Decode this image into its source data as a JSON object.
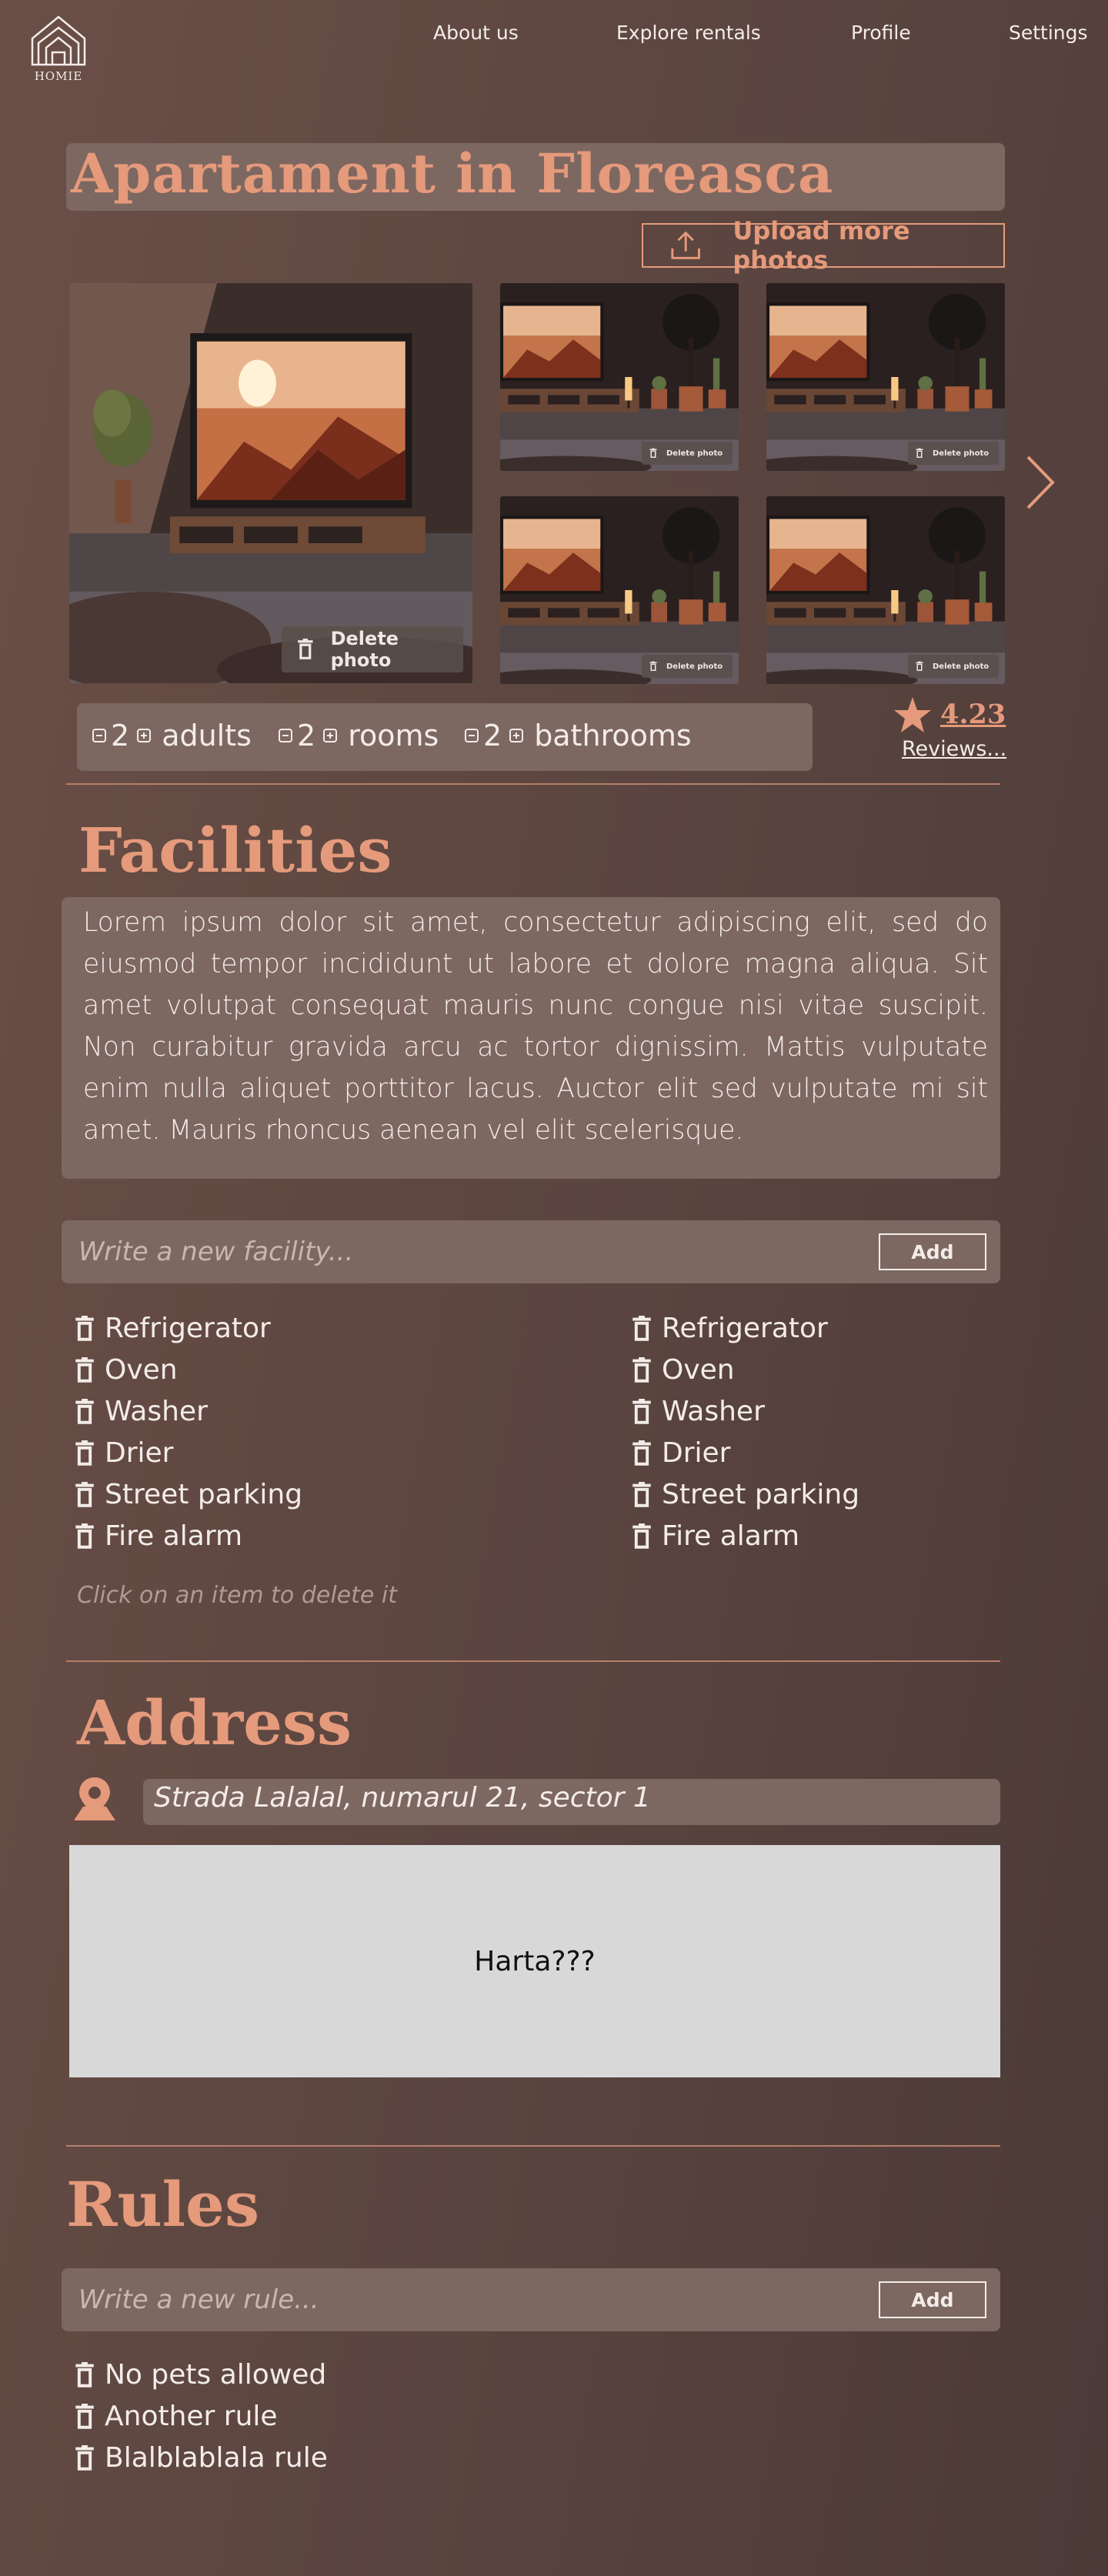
{
  "brand": {
    "name": "HOMIE"
  },
  "nav": {
    "about": "About us",
    "explore": "Explore rentals",
    "profile": "Profile",
    "settings": "Settings"
  },
  "listing": {
    "title": "Apartament in Floreasca",
    "upload_label": "Upload more photos",
    "delete_photo_label": "Delete photo",
    "counters": {
      "adults": {
        "value": "2",
        "unit": "adults"
      },
      "rooms": {
        "value": "2",
        "unit": "rooms"
      },
      "bathrooms": {
        "value": "2",
        "unit": "bathrooms"
      }
    },
    "rating": "4.23",
    "reviews_link": "Reviews..."
  },
  "facilities": {
    "heading": "Facilities",
    "description": "Lorem ipsum dolor sit amet, consectetur adipiscing elit, sed do eiusmod tempor incididunt ut labore et dolore magna aliqua. Sit amet volutpat consequat mauris nunc congue nisi vitae suscipit. Non curabitur gravida arcu ac tortor dignissim. Mattis vulputate enim nulla aliquet porttitor lacus. Auctor elit sed vulputate mi sit amet. Mauris rhoncus aenean vel elit scelerisque.",
    "input_placeholder": "Write a new facility...",
    "add_label": "Add",
    "left": [
      "Refrigerator",
      "Oven",
      "Washer",
      "Drier",
      "Street parking",
      "Fire alarm"
    ],
    "right": [
      "Refrigerator",
      "Oven",
      "Washer",
      "Drier",
      "Street parking",
      "Fire alarm"
    ],
    "hint": "Click on an item to delete it"
  },
  "address": {
    "heading": "Address",
    "value": "Strada Lalalal, numarul 21, sector 1",
    "map_placeholder": "Harta???"
  },
  "rules": {
    "heading": "Rules",
    "input_placeholder": "Write a new rule...",
    "add_label": "Add",
    "items": [
      "No pets allowed",
      "Another rule",
      "Blalblablala rule"
    ]
  },
  "colors": {
    "accent": "#e59a7b",
    "panel": "#7d6761",
    "background": "#5a443f"
  }
}
